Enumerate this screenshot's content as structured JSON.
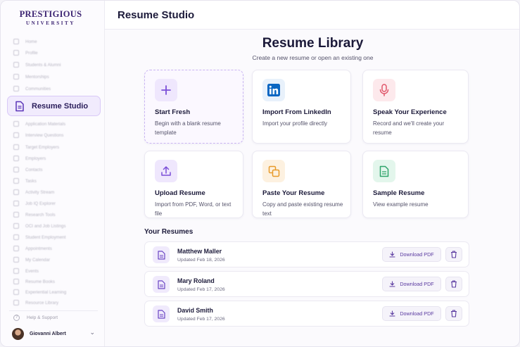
{
  "brand": {
    "line1": "PRESTIGIOUS",
    "line2": "UNIVERSITY"
  },
  "sidebar": {
    "items_top": [
      {
        "label": "Home",
        "icon": "home-icon"
      },
      {
        "label": "Profile",
        "icon": "user-icon"
      },
      {
        "label": "Students & Alumni",
        "icon": "users-icon"
      },
      {
        "label": "Mentorships",
        "icon": "handshake-icon"
      },
      {
        "label": "Communities",
        "icon": "community-icon"
      }
    ],
    "active": {
      "label": "Resume Studio",
      "icon": "document-icon"
    },
    "items_bottom": [
      {
        "label": "Application Materials",
        "icon": "folder-icon"
      },
      {
        "label": "Interview Questions",
        "icon": "chat-icon"
      },
      {
        "label": "Target Employers",
        "icon": "target-icon"
      },
      {
        "label": "Employers",
        "icon": "building-icon"
      },
      {
        "label": "Contacts",
        "icon": "contacts-icon"
      },
      {
        "label": "Tasks",
        "icon": "check-icon"
      },
      {
        "label": "Activity Stream",
        "icon": "activity-icon"
      },
      {
        "label": "Job IQ Explorer",
        "icon": "compass-icon"
      },
      {
        "label": "Research Tools",
        "icon": "search-icon"
      },
      {
        "label": "OCI and Job Listings",
        "icon": "list-icon"
      },
      {
        "label": "Student Employment",
        "icon": "briefcase-icon"
      },
      {
        "label": "Appointments",
        "icon": "calendar-icon"
      },
      {
        "label": "My Calendar",
        "icon": "calendar-icon"
      },
      {
        "label": "Events",
        "icon": "star-icon"
      },
      {
        "label": "Resume Books",
        "icon": "book-icon"
      },
      {
        "label": "Experiential Learning",
        "icon": "lightbulb-icon"
      },
      {
        "label": "Resource Library",
        "icon": "library-icon"
      }
    ],
    "help": "Help & Support",
    "user_name": "Giovanni Albert"
  },
  "header": {
    "title": "Resume Studio"
  },
  "main": {
    "title": "Resume Library",
    "subtitle": "Create a new resume or open an existing one",
    "cards": [
      {
        "title": "Start Fresh",
        "desc": "Begin with a blank resume template",
        "icon": "plus-icon",
        "accent": "#7b4fd8",
        "bg": "#efe7fd"
      },
      {
        "title": "Import From LinkedIn",
        "desc": "Import your profile directly",
        "icon": "linkedin-icon",
        "accent": "#0a66c2",
        "bg": "#e8f1fb"
      },
      {
        "title": "Speak Your Experience",
        "desc": "Record and we'll create your resume",
        "icon": "microphone-icon",
        "accent": "#e0566a",
        "bg": "#fde9ec"
      },
      {
        "title": "Upload Resume",
        "desc": "Import from PDF, Word, or text file",
        "icon": "upload-icon",
        "accent": "#7b4fd8",
        "bg": "#efe7fd"
      },
      {
        "title": "Paste Your Resume",
        "desc": "Copy and paste existing resume text",
        "icon": "copy-icon",
        "accent": "#e79a2a",
        "bg": "#fdf1e0"
      },
      {
        "title": "Sample Resume",
        "desc": "View example resume",
        "icon": "file-text-icon",
        "accent": "#2fa46a",
        "bg": "#e3f6ec"
      }
    ],
    "section_title": "Your Resumes",
    "resumes": [
      {
        "name": "Matthew Maller",
        "updated": "Updated Feb 18, 2026",
        "download": "Download PDF"
      },
      {
        "name": "Mary Roland",
        "updated": "Updated Feb 17, 2026",
        "download": "Download PDF"
      },
      {
        "name": "David Smith",
        "updated": "Updated Feb 17, 2026",
        "download": "Download PDF"
      }
    ]
  }
}
